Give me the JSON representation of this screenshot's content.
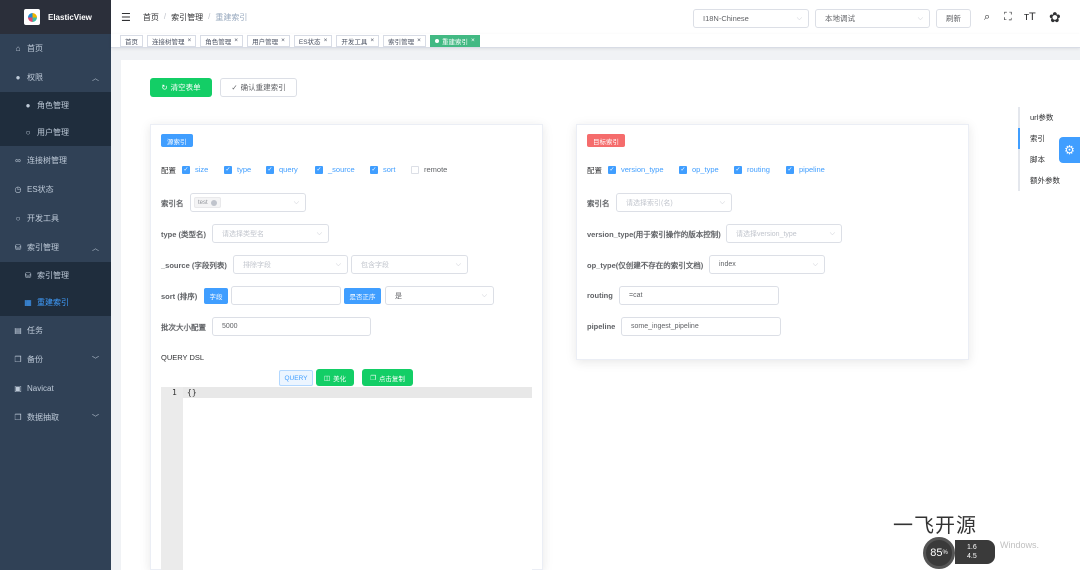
{
  "app": {
    "title": "ElasticView"
  },
  "sidebar": {
    "items": [
      {
        "icon": "home-icon",
        "label": "首页"
      },
      {
        "icon": "user-icon",
        "label": "权限"
      },
      {
        "icon": "user-filled-icon",
        "label": "角色管理"
      },
      {
        "icon": "user-outline-icon",
        "label": "用户管理"
      },
      {
        "icon": "link-icon",
        "label": "连接树管理"
      },
      {
        "icon": "clock-icon",
        "label": "ES状态"
      },
      {
        "icon": "search-icon",
        "label": "开发工具"
      },
      {
        "icon": "database-icon",
        "label": "索引管理"
      },
      {
        "icon": "database-icon",
        "label": "索引管理"
      },
      {
        "icon": "rebuild-icon",
        "label": "重建索引"
      },
      {
        "icon": "document-icon",
        "label": "任务"
      },
      {
        "icon": "copy-icon",
        "label": "备份"
      },
      {
        "icon": "terminal-icon",
        "label": "Navicat"
      },
      {
        "icon": "copy-icon",
        "label": "数据抽取"
      }
    ]
  },
  "header": {
    "breadcrumb": [
      "首页",
      "索引管理",
      "重建索引"
    ],
    "separator": "/",
    "language_select": "I18N-Chinese",
    "env_select": "本地调试",
    "refresh_label": "刷新"
  },
  "tags": [
    {
      "label": "首页"
    },
    {
      "label": "连接树管理"
    },
    {
      "label": "角色管理"
    },
    {
      "label": "用户管理"
    },
    {
      "label": "ES状态"
    },
    {
      "label": "开发工具"
    },
    {
      "label": "索引管理"
    },
    {
      "label": "重建索引",
      "active": true
    }
  ],
  "actions": {
    "clear_label": "清空表单",
    "confirm_label": "确认重建索引"
  },
  "source": {
    "title": "源索引",
    "config_label": "配置",
    "checks": [
      {
        "label": "size",
        "checked": true
      },
      {
        "label": "type",
        "checked": true
      },
      {
        "label": "query",
        "checked": true
      },
      {
        "label": "_source",
        "checked": true
      },
      {
        "label": "sort",
        "checked": true
      },
      {
        "label": "remote",
        "checked": false
      }
    ],
    "index_label": "索引名",
    "index_tag": "test",
    "type_label": "type (类型名)",
    "type_placeholder": "请选择类型名",
    "source_label": "_source (字段列表)",
    "exclude_placeholder": "排除字段",
    "include_placeholder": "包含字段",
    "sort_label": "sort (排序)",
    "field_btn": "字段",
    "asc_btn": "是否正序",
    "asc_value": "是",
    "batch_label": "批次大小配置",
    "batch_value": "5000",
    "dsl_label": "QUERY DSL",
    "query_btn": "QUERY",
    "beautify_btn": "美化",
    "copy_btn": "点击复制",
    "editor_line": "1",
    "editor_text": "{}"
  },
  "target": {
    "title": "目标索引",
    "config_label": "配置",
    "checks": [
      {
        "label": "version_type",
        "checked": true
      },
      {
        "label": "op_type",
        "checked": true
      },
      {
        "label": "routing",
        "checked": true
      },
      {
        "label": "pipeline",
        "checked": true
      }
    ],
    "index_label": "索引名",
    "index_placeholder": "请选择索引(名)",
    "version_label": "version_type(用于索引操作的版本控制)",
    "version_placeholder": "请选择version_type",
    "optype_label": "op_type(仅创建不存在的索引文档)",
    "optype_value": "index",
    "routing_label": "routing",
    "routing_value": "=cat",
    "pipeline_label": "pipeline",
    "pipeline_value": "some_ingest_pipeline"
  },
  "anchor": [
    "url参数",
    "索引",
    "脚本",
    "额外参数"
  ],
  "overlay": {
    "watermark": "一飞开源",
    "speed": "85",
    "speed_unit": "%",
    "up": "1.6",
    "down": "4.5",
    "windows_text": "Windows."
  }
}
